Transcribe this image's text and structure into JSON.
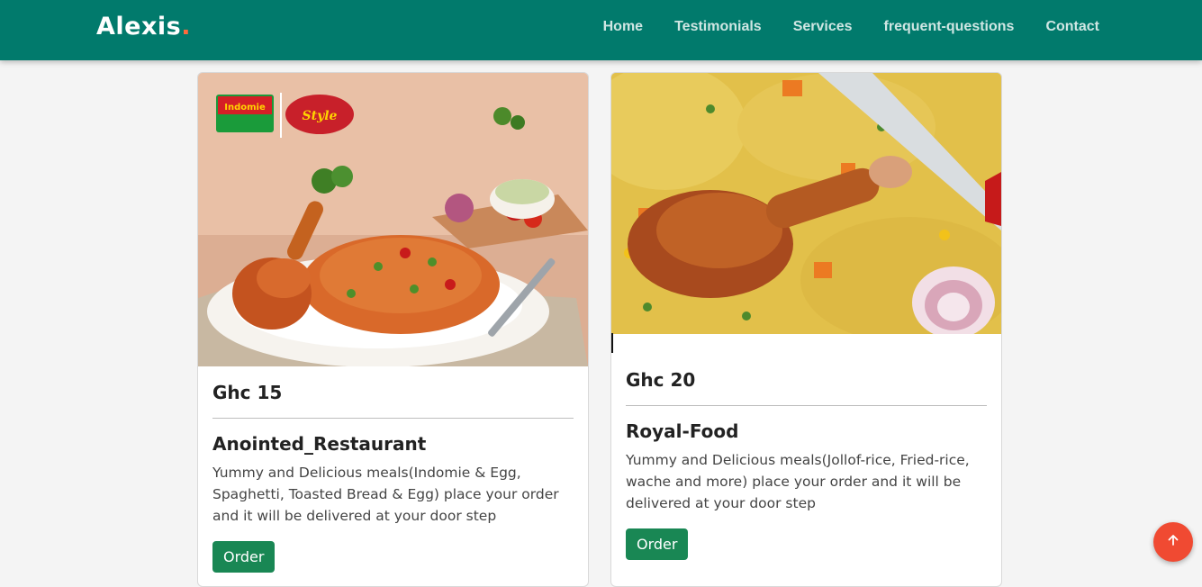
{
  "nav": {
    "brand": "Alexis",
    "brand_dot": ".",
    "links": [
      "Home",
      "Testimonials",
      "Services",
      "frequent-questions",
      "Contact"
    ]
  },
  "cards": [
    {
      "price": "Ghc 15",
      "name": "Anointed_Restaurant",
      "description": "Yummy and Delicious meals(Indomie & Egg, Spaghetti, Toasted Bread & Egg) place your order and it will be delivered at your door step",
      "button": "Order",
      "image": "indomie-chicken-plate"
    },
    {
      "price": "Ghc 20",
      "name": "Royal-Food",
      "description": "Yummy and Delicious meals(Jollof-rice, Fried-rice, wache and more) place your order and it will be delivered at your door step",
      "button": "Order",
      "image": "fried-rice-chicken"
    }
  ],
  "scroll_top_icon": "arrow-up-icon",
  "colors": {
    "navbar": "#017a6c",
    "brand_dot": "#ff6a3c",
    "order_button": "#198754",
    "scroll_top": "#f04a32"
  }
}
